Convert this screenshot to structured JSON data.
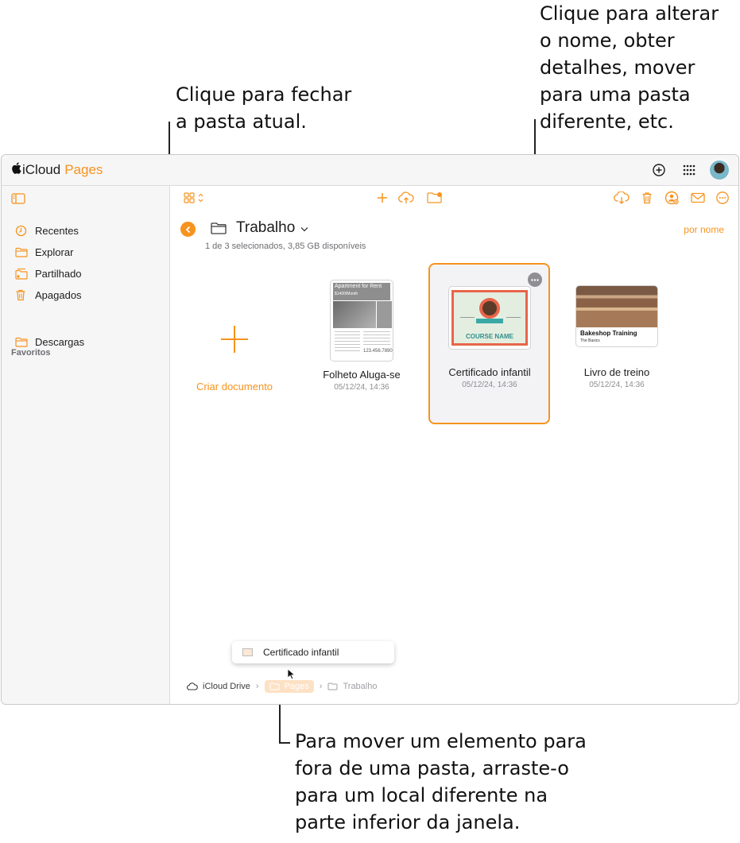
{
  "callouts": {
    "close_folder": "Clique para fechar\na pasta atual.",
    "more_options": "Clique para alterar\no nome, obter\ndetalhes, mover\npara uma pasta\ndiferente, etc.",
    "drag_out": "Para mover um elemento para\nfora de uma pasta, arraste-o\npara um local diferente na\nparte inferior da janela."
  },
  "app": {
    "brand_icloud": "iCloud",
    "brand_pages": "Pages"
  },
  "sidebar": {
    "items": [
      {
        "label": "Recentes",
        "icon": "clock-icon"
      },
      {
        "label": "Explorar",
        "icon": "folder-icon"
      },
      {
        "label": "Partilhado",
        "icon": "shared-folder-icon"
      },
      {
        "label": "Apagados",
        "icon": "trash-icon"
      }
    ],
    "favorites_title": "Favoritos",
    "favorites": [
      {
        "label": "Descargas",
        "icon": "folder-icon"
      }
    ]
  },
  "folder": {
    "title": "Trabalho",
    "subtitle": "1 de 3 selecionados, 3,85 GB disponíveis",
    "sort_label": "por nome"
  },
  "documents": [
    {
      "name": "Criar documento",
      "date": ""
    },
    {
      "name": "Folheto Aluga-se",
      "date": "05/12/24, 14:36"
    },
    {
      "name": "Certificado infantil",
      "date": "05/12/24, 14:36"
    },
    {
      "name": "Livro de treino",
      "date": "05/12/24, 14:36"
    }
  ],
  "thumbnails": {
    "flyer_title": "Apartment for Rent",
    "flyer_price": "$1400/Month",
    "flyer_phone": "123.456.7890",
    "certificate_course": "COURSE NAME",
    "bakeshop_title": "Bakeshop Training",
    "bakeshop_sub": "The Basics"
  },
  "drag_item": {
    "label": "Certificado infantil"
  },
  "breadcrumbs": [
    "iCloud Drive",
    "Pages",
    "Trabalho"
  ],
  "colors": {
    "accent": "#f7931e",
    "selection_bg": "#f3f3f6"
  }
}
